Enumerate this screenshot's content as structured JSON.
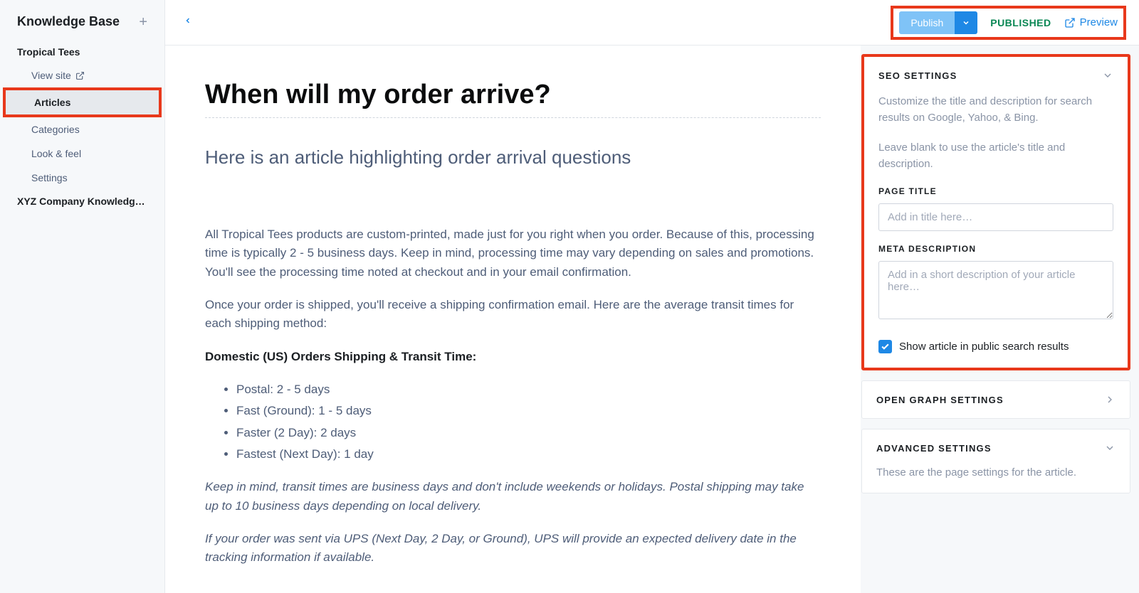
{
  "sidebar": {
    "title": "Knowledge Base",
    "sites": [
      {
        "name": "Tropical Tees",
        "items": [
          {
            "label": "View site",
            "external": true
          },
          {
            "label": "Articles",
            "active": true
          },
          {
            "label": "Categories"
          },
          {
            "label": "Look & feel"
          },
          {
            "label": "Settings"
          }
        ]
      },
      {
        "name": "XYZ Company Knowledg…"
      }
    ]
  },
  "topbar": {
    "publish_label": "Publish",
    "status": "PUBLISHED",
    "preview_label": "Preview"
  },
  "article": {
    "title": "When will my order arrive?",
    "subtitle": "Here is an article highlighting order arrival questions",
    "p1": "All Tropical Tees products are custom-printed, made just for you right when you order. Because of this, processing time is typically 2 - 5 business days. Keep in mind, processing time may vary depending on sales and promotions. You'll see the processing time noted at checkout and in your email confirmation.",
    "p2": "Once your order is shipped, you'll receive a shipping confirmation email. Here are the average transit times for each shipping method:",
    "heading1": "Domestic (US) Orders Shipping & Transit Time:",
    "list": [
      "Postal: 2 - 5 days",
      "Fast (Ground): 1 - 5 days",
      "Faster (2 Day): 2 days",
      "Fastest (Next Day): 1 day"
    ],
    "p3": "Keep in mind, transit times are business days and don't include weekends or holidays. Postal shipping may take up to 10 business days depending on local delivery.",
    "p4": "If your order was sent via UPS (Next Day, 2 Day, or Ground), UPS will provide an expected delivery date in the tracking information if available."
  },
  "seo": {
    "title": "SEO SETTINGS",
    "help1": "Customize the title and description for search results on Google, Yahoo, & Bing.",
    "help2": "Leave blank to use the article's title and description.",
    "page_title_label": "PAGE TITLE",
    "page_title_placeholder": "Add in title here…",
    "meta_label": "META DESCRIPTION",
    "meta_placeholder": "Add in a short description of your article here…",
    "checkbox_label": "Show article in public search results"
  },
  "og": {
    "title": "OPEN GRAPH SETTINGS"
  },
  "adv": {
    "title": "ADVANCED SETTINGS",
    "subtext": "These are the page settings for the article."
  }
}
